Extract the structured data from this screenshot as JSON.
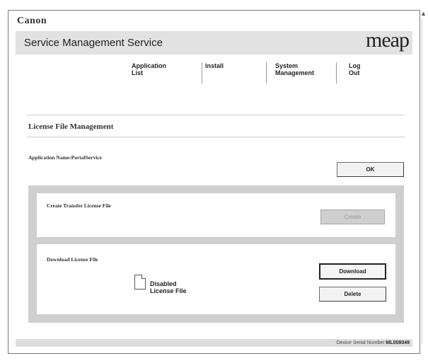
{
  "brand": "Canon",
  "header": {
    "title": "Service Management Service",
    "logo": "meap"
  },
  "nav": {
    "items": [
      {
        "label": "Application List"
      },
      {
        "label": "Install"
      },
      {
        "label": "System\nManagement"
      },
      {
        "label": "Log Out"
      }
    ]
  },
  "section": {
    "title": "License File Management"
  },
  "app": {
    "name": "Application Name:PortalService"
  },
  "buttons": {
    "ok": "OK",
    "create": "Create",
    "download": "Download",
    "delete": "Delete"
  },
  "panels": {
    "transfer": {
      "title": "Create Transfer License File"
    },
    "download": {
      "title": "Download License File",
      "file_label": "Disabled\nLicense File"
    }
  },
  "footer": {
    "serial_label": "Device Serial Number:",
    "serial_value": "ML008049"
  },
  "colors": {
    "header_bg": "#e2e2e2",
    "panel_bg": "#cfcfcf",
    "footer_bg": "#dedede"
  }
}
